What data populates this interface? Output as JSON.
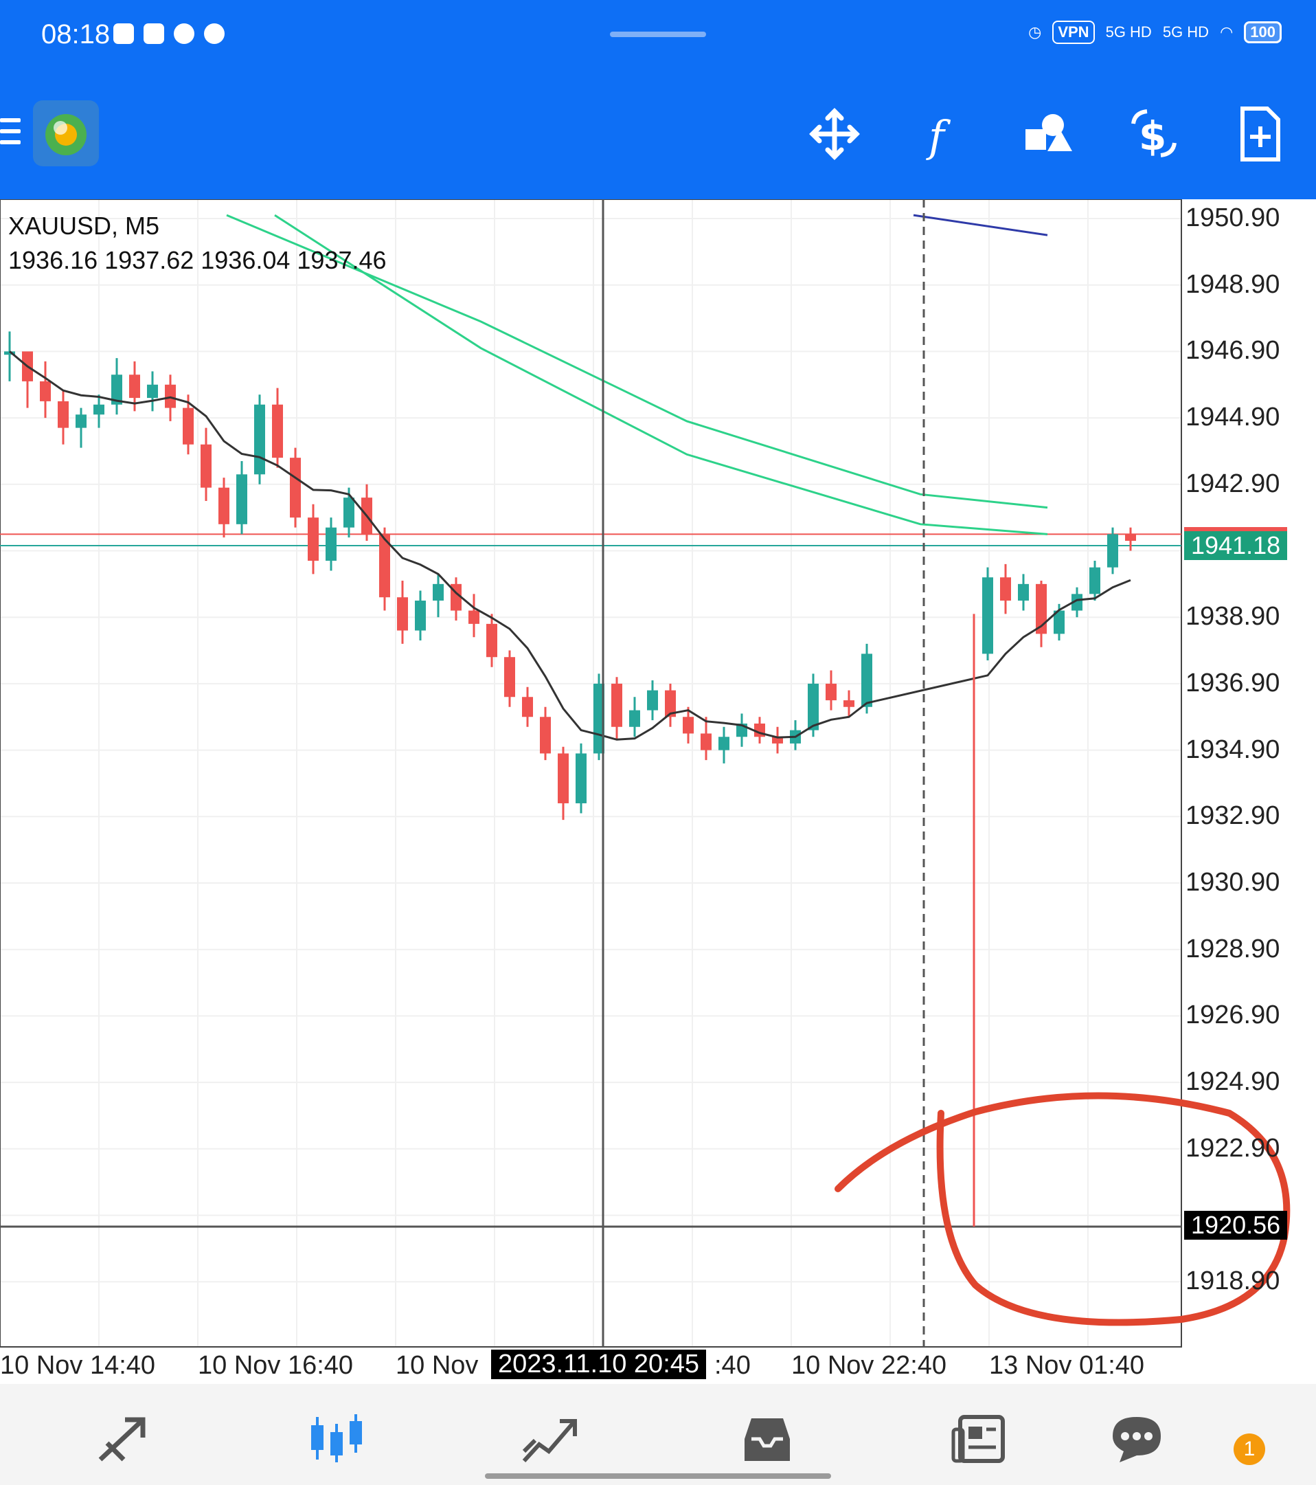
{
  "status_bar": {
    "time": "08:18",
    "vpn": "VPN",
    "network1": "5G HD",
    "network2": "5G HD",
    "battery": "100"
  },
  "toolbar": {
    "icons": [
      "menu-icon",
      "app-logo-icon",
      "crosshair-move-icon",
      "indicators-icon",
      "objects-icon",
      "trade-dollar-icon",
      "new-order-icon"
    ]
  },
  "chart": {
    "symbol": "XAUUSD, M5",
    "ohlc": "1936.16 1937.62 1936.04 1937.46",
    "y_labels": [
      "1950.90",
      "1948.90",
      "1946.90",
      "1944.90",
      "1942.90",
      "1938.90",
      "1936.90",
      "1934.90",
      "1932.90",
      "1930.90",
      "1928.90",
      "1926.90",
      "1924.90",
      "1922.90",
      "1918.90"
    ],
    "bid_price": "1941.18",
    "crosshair_price": "1920.56",
    "x_labels": [
      "10 Nov 14:40",
      "10 Nov 16:40",
      "10 Nov",
      ":40",
      "10 Nov 22:40",
      "13 Nov 01:40"
    ],
    "crosshair_time": "2023.11.10 20:45",
    "colors": {
      "bull": "#26a69a",
      "bear": "#ef5350",
      "ma_fast": "#333333",
      "ma_green": "#2dd28a",
      "ma_blue": "#2e3aa8",
      "annotation": "#e0452e"
    }
  },
  "bottom_nav": {
    "items": [
      "quotes-icon",
      "chart-icon",
      "trade-icon",
      "history-icon",
      "news-icon",
      "messages-icon"
    ],
    "badge": "1"
  }
}
